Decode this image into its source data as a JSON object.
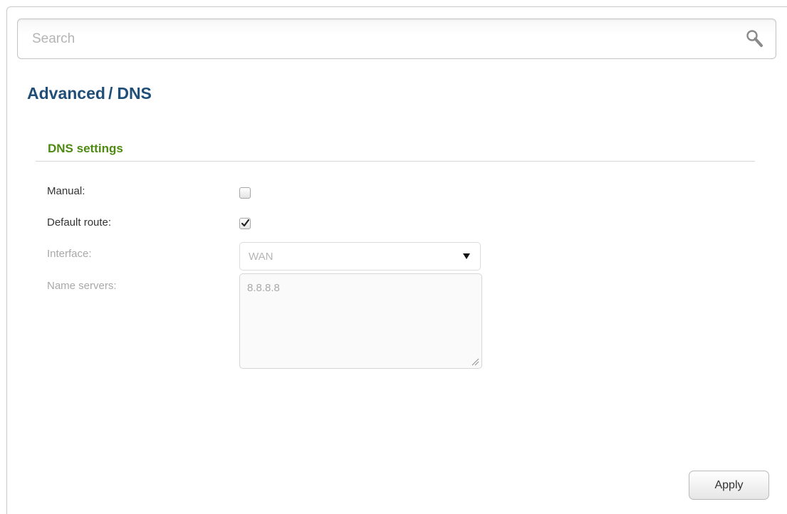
{
  "search": {
    "placeholder": "Search",
    "icon": "search-icon"
  },
  "breadcrumb": {
    "parent": "Advanced",
    "separator": "/",
    "current": "DNS"
  },
  "section": {
    "title": "DNS settings"
  },
  "fields": {
    "manual": {
      "label": "Manual:",
      "checked": false
    },
    "default_route": {
      "label": "Default route:",
      "checked": true
    },
    "interface": {
      "label": "Interface:",
      "value": "WAN",
      "disabled": true
    },
    "name_servers": {
      "label": "Name servers:",
      "value": "8.8.8.8",
      "disabled": true
    }
  },
  "actions": {
    "apply_label": "Apply"
  },
  "colors": {
    "breadcrumb": "#1f4e79",
    "section_title": "#4e8a12",
    "label": "#333333",
    "label_disabled": "#a8a8a8"
  }
}
